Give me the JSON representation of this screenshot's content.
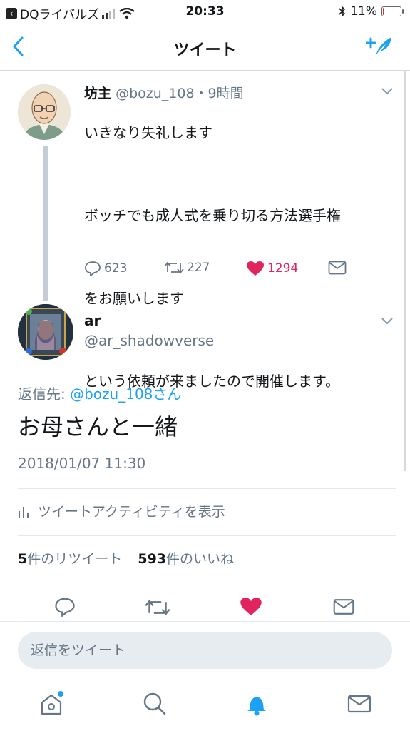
{
  "status_bar": {
    "back_app": "DQライバルズ",
    "time": "20:33",
    "battery": "11%",
    "battery_level": 0.11
  },
  "nav": {
    "title": "ツイート"
  },
  "thread_tweet": {
    "name": "坊主",
    "handle_time": "@bozu_108・9時間",
    "lines": [
      "いきなり失礼します",
      "ボッチでも成人式を乗り切る方法選手権",
      "をお願いします",
      "という依頼が来ましたので開催します。"
    ],
    "replies": "623",
    "retweets": "227",
    "likes": "1294"
  },
  "main_tweet": {
    "name": "ar",
    "handle": "@ar_shadowverse",
    "reply_prefix": "返信先: ",
    "reply_to": "@bozu_108さん",
    "text": "お母さんと一緒",
    "timestamp": "2018/01/07 11:30",
    "activity_label": "ツイートアクティビティを表示",
    "retweet_count": "5",
    "retweet_label": "件のリツイート",
    "like_count": "593",
    "like_label": "件のいいね"
  },
  "reply_bar": {
    "placeholder": "返信をツイート"
  },
  "colors": {
    "accent": "#1da1f2",
    "like": "#e0245e",
    "muted": "#657786"
  }
}
